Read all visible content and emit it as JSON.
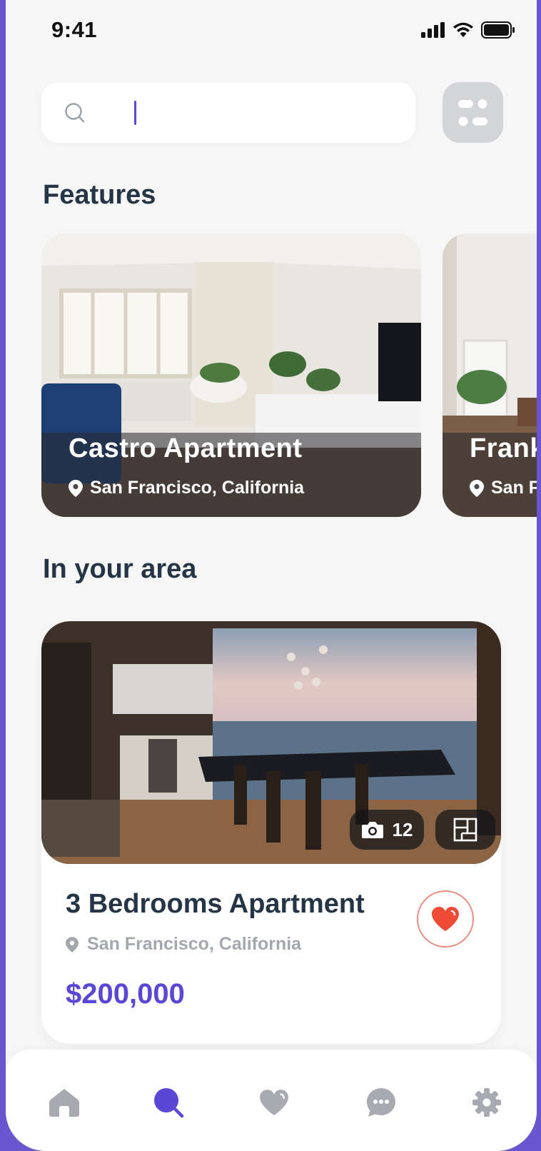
{
  "status_bar": {
    "time": "9:41"
  },
  "search": {
    "placeholder": "",
    "value": ""
  },
  "features": {
    "title": "Features",
    "cards": [
      {
        "name": "Castro Apartment",
        "location": "San Francisco, California"
      },
      {
        "name": "Frank",
        "location": "San F"
      }
    ]
  },
  "area": {
    "title": "In your area",
    "listing": {
      "title": "3 Bedrooms Apartment",
      "location": "San Francisco, California",
      "price": "$200,000",
      "photo_count": "12",
      "favorited": true
    }
  },
  "tabbar": {
    "items": [
      {
        "icon": "home-icon",
        "active": false
      },
      {
        "icon": "search-icon",
        "active": true
      },
      {
        "icon": "heart-icon",
        "active": false
      },
      {
        "icon": "chat-icon",
        "active": false
      },
      {
        "icon": "gear-icon",
        "active": false
      }
    ]
  },
  "colors": {
    "accent": "#5b47d6",
    "frame": "#6a56cf",
    "heart": "#ee4a36",
    "title": "#253545"
  }
}
